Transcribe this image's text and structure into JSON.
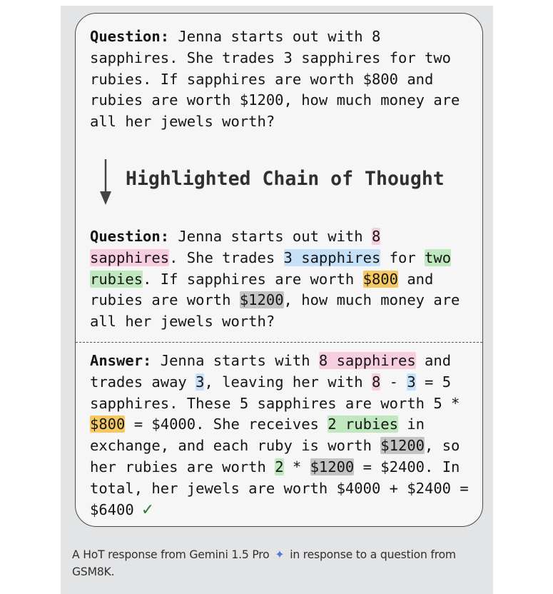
{
  "question": {
    "label": "Question:",
    "lines": [
      " Jenna starts out with 8",
      "sapphires. She trades 3 sapphires for two",
      "rubies. If sapphires are worth $800 and",
      "rubies are worth $1200, how much money are",
      "all her jewels worth?"
    ]
  },
  "hot_title": "Highlighted Chain of Thought",
  "highlighted_question": {
    "label": "Question:",
    "seg": [
      " Jenna starts out with ",
      "8",
      "sapphires",
      ". She trades ",
      "3 sapphires",
      " for ",
      "two",
      "rubies",
      ". If sapphires are worth ",
      "$800",
      " and",
      "rubies are worth ",
      "$1200",
      ", how much money are",
      "all her jewels worth?"
    ]
  },
  "answer": {
    "label": "Answer:",
    "seg": [
      " Jenna starts with ",
      "8 sapphires",
      " and",
      "trades away ",
      "3",
      ", leaving her with ",
      "8",
      " - ",
      "3",
      " = 5",
      "sapphires. These 5 sapphires are worth 5 *",
      "$800",
      " = $4000. She receives ",
      "2 rubies",
      " in",
      "exchange, and each ruby is worth ",
      "$1200",
      ", so",
      "her rubies are worth ",
      "2",
      " * ",
      "$1200",
      " = $2400. In",
      "total, her jewels are worth $4000 + $2400 =",
      "$6400"
    ],
    "check_icon": "✓"
  },
  "colors": {
    "pink": "#f7cde0",
    "blue": "#c6e0f7",
    "green": "#bfe8be",
    "yellow": "#f6c862",
    "gray": "#c4c4c4"
  },
  "caption": {
    "part1": "A HoT response from Gemini 1.5 Pro",
    "sparkle_icon": "✦",
    "part2": " in response to a question from GSM8K."
  }
}
